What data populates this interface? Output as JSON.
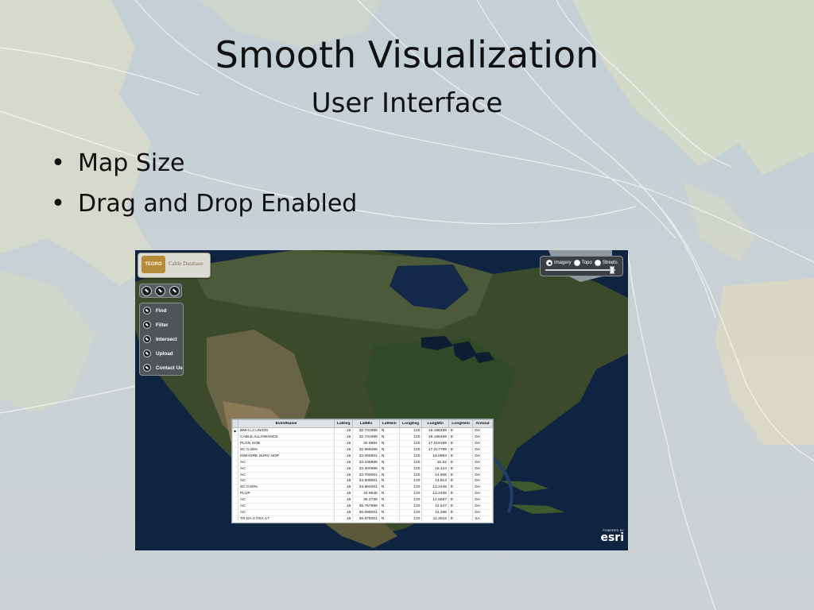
{
  "slide": {
    "title": "Smooth Visualization",
    "subtitle": "User Interface",
    "bullets": [
      {
        "dot": "•",
        "text": "Map Size"
      },
      {
        "dot": "•",
        "text": "Drag and Drop Enabled"
      }
    ]
  },
  "app": {
    "logo_mark": "TEGRO",
    "logo_text": "Cable Database",
    "side_menu": [
      "Find",
      "Filter",
      "Intersect",
      "Upload",
      "Contact Us"
    ],
    "basemaps": [
      {
        "label": "Imagery",
        "selected": true
      },
      {
        "label": "Topo",
        "selected": false
      },
      {
        "label": "Streets",
        "selected": false
      }
    ],
    "esri_powered": "POWERED BY",
    "esri_word": "esri",
    "selected_row_marker": "▶"
  },
  "table": {
    "columns": [
      "EventName",
      "LatDeg",
      "LatMin",
      "LatHem",
      "LongDeg",
      "LongMin",
      "LongHem",
      "Armour"
    ],
    "rows": [
      [
        "BMH LA UNION",
        "16",
        "32.731998",
        "N",
        "120",
        "19.186499",
        "E",
        "DA"
      ],
      [
        "CABLE ALLOWANCE",
        "16",
        "32.731998",
        "N",
        "120",
        "19.186499",
        "E",
        "DA"
      ],
      [
        "PLGN SOB",
        "16",
        "32.9594",
        "N",
        "120",
        "17.019199",
        "E",
        "DA"
      ],
      [
        "SC 0.25%",
        "16",
        "32.959499",
        "N",
        "120",
        "17.017799",
        "E",
        "DA"
      ],
      [
        "INSHORE SURV HOP",
        "16",
        "33.055801",
        "N",
        "120",
        "16.0993",
        "E",
        "DA"
      ],
      [
        "AC",
        "16",
        "33.105999",
        "N",
        "120",
        "15.62",
        "E",
        "DA"
      ],
      [
        "AC",
        "16",
        "33.300999",
        "N",
        "120",
        "15.124",
        "E",
        "DA"
      ],
      [
        "AC",
        "16",
        "33.700001",
        "N",
        "120",
        "14.606",
        "E",
        "DA"
      ],
      [
        "AC",
        "16",
        "34.609001",
        "N",
        "120",
        "13.913",
        "E",
        "DA"
      ],
      [
        "SC 0.50%",
        "16",
        "34.984001",
        "N",
        "120",
        "13.2445",
        "E",
        "DA"
      ],
      [
        "PLUP",
        "16",
        "34.9645",
        "N",
        "120",
        "13.2436",
        "E",
        "DA"
      ],
      [
        "AC",
        "16",
        "35.2739",
        "N",
        "120",
        "12.6067",
        "E",
        "DA"
      ],
      [
        "AC",
        "16",
        "35.757999",
        "N",
        "120",
        "12.547",
        "E",
        "DA"
      ],
      [
        "AC",
        "16",
        "36.096001",
        "N",
        "120",
        "12.286",
        "E",
        "DA"
      ],
      [
        "TR DA-17/SA-17",
        "16",
        "36.875001",
        "N",
        "120",
        "11.3016",
        "E",
        "SA"
      ]
    ]
  }
}
